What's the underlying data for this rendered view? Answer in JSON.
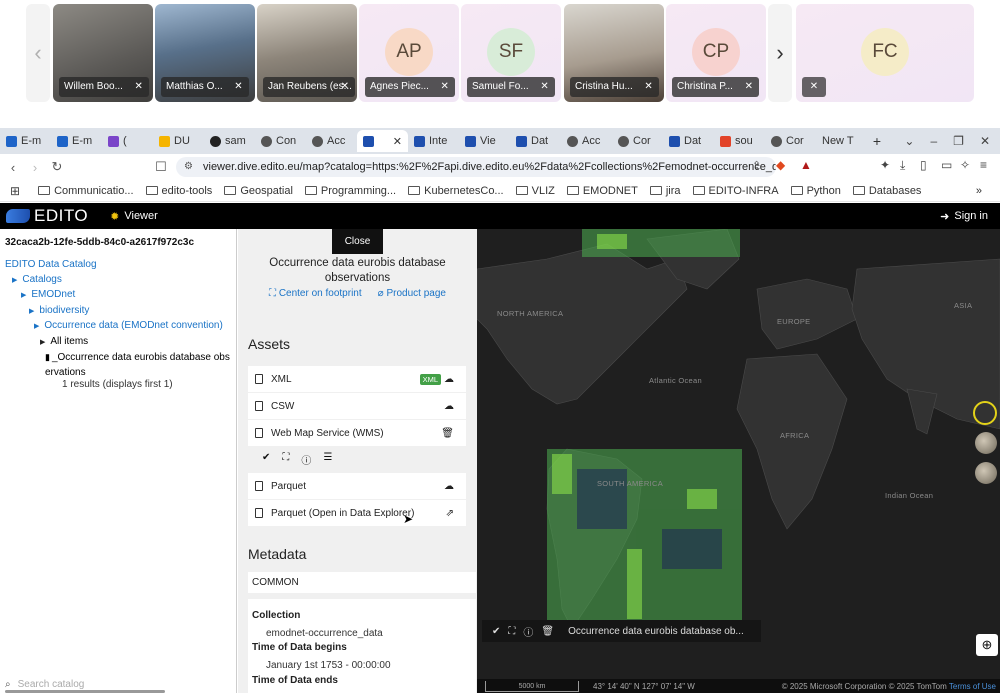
{
  "meeting": {
    "participants": [
      {
        "name": "Willem Boo...",
        "type": "photo"
      },
      {
        "name": "Matthias O...",
        "type": "photo"
      },
      {
        "name": "Jan Reubens (es...",
        "type": "photo"
      },
      {
        "name": "Agnes Piec...",
        "type": "avatar",
        "initials": "AP",
        "color": "#f8d9c6"
      },
      {
        "name": "Samuel Fo...",
        "type": "avatar",
        "initials": "SF",
        "color": "#d8ecd8"
      },
      {
        "name": "Cristina Hu...",
        "type": "photo"
      },
      {
        "name": "Christina P...",
        "type": "avatar",
        "initials": "CP",
        "color": "#f7d2cf"
      },
      {
        "name": "",
        "type": "avatar",
        "initials": "FC",
        "color": "#f5ecc8"
      }
    ],
    "prev_icon": "chevron-left-icon",
    "next_icon": "chevron-right-icon"
  },
  "browser": {
    "tabs": [
      {
        "label": "E-m",
        "favicon": "#1e64c8"
      },
      {
        "label": "E-m",
        "favicon": "#1e64c8"
      },
      {
        "label": "(",
        "favicon": "#7b45c9"
      },
      {
        "label": "DU",
        "favicon": "#f5b400"
      },
      {
        "label": "sam",
        "favicon": "#222222"
      },
      {
        "label": "Con",
        "favicon": "#555555"
      },
      {
        "label": "Acc",
        "favicon": "#555555"
      },
      {
        "label": "",
        "favicon": "#1e4fae",
        "active": true
      },
      {
        "label": "Inte",
        "favicon": "#1e4fae"
      },
      {
        "label": "Vie",
        "favicon": "#1e4fae"
      },
      {
        "label": "Dat",
        "favicon": "#1e4fae"
      },
      {
        "label": "Acc",
        "favicon": "#555555"
      },
      {
        "label": "Cor",
        "favicon": "#555555"
      },
      {
        "label": "Dat",
        "favicon": "#1e4fae"
      },
      {
        "label": "sou",
        "favicon": "#e24329"
      },
      {
        "label": "Cor",
        "favicon": "#555555"
      },
      {
        "label": "New T",
        "favicon": ""
      }
    ],
    "new_tab": "+",
    "url": "viewer.dive.edito.eu/map?catalog=https:%2F%2Fapi.dive.edito.eu%2Fdata%2Fcollections%2Femodnet-occurrence_data%...",
    "bookmarks": [
      "Communicatio...",
      "edito-tools",
      "Geospatial",
      "Programming...",
      "KubernetesCo...",
      "VLIZ",
      "EMODNET",
      "jira",
      "EDITO-INFRA",
      "Python",
      "Databases"
    ],
    "more": "»"
  },
  "app": {
    "logo": "EDITO",
    "section": "Viewer",
    "signin": "Sign in"
  },
  "catalog": {
    "item_id": "32caca2b-12fe-5ddb-84c0-a2617f972c3c",
    "tree": {
      "root": "EDITO Data Catalog",
      "catalogs": "Catalogs",
      "emodnet": "EMODnet",
      "biodiversity": "biodiversity",
      "occurrence": "Occurrence data (EMODnet convention)",
      "all_items": "All items",
      "item_line1": "_Occurrence data eurobis database obs",
      "item_line2": "ervations"
    },
    "results": "1 results (displays first 1)",
    "search_placeholder": "Search catalog"
  },
  "detail": {
    "close": "Close",
    "title": "Occurrence data eurobis database observations",
    "center": "Center on footprint",
    "product": "Product page",
    "assets_heading": "Assets",
    "assets": [
      {
        "label": "XML",
        "tag": "XML",
        "icon": "cloud-download-icon"
      },
      {
        "label": "CSW",
        "icon": "cloud-download-icon"
      },
      {
        "label": "Web Map Service (WMS)",
        "icon": "trash-icon"
      },
      {
        "label": "Parquet",
        "icon": "cloud-download-icon"
      },
      {
        "label": "Parquet (Open in Data Explorer)",
        "icon": "external-link-icon"
      }
    ],
    "metadata_heading": "Metadata",
    "metadata_section": "COMMON",
    "collection_key": "Collection",
    "collection_val": "emodnet-occurrence_data",
    "begins_key": "Time of Data begins",
    "begins_val": "January 1st 1753 - 00:00:00",
    "ends_key": "Time of Data ends"
  },
  "map": {
    "labels": {
      "north_america": "NORTH AMERICA",
      "europe": "EUROPE",
      "asia": "ASIA",
      "africa": "AFRICA",
      "south_america": "SOUTH AMERICA",
      "atlantic": "Atlantic Ocean",
      "indian": "Indian Ocean"
    },
    "layer_name": "Occurrence data eurobis database ob...",
    "scale": "5000 km",
    "coords": "43° 14' 40\" N 127° 07' 14\" W",
    "attribution": "© 2025 Microsoft Corporation © 2025 TomTom",
    "terms": "Terms of Use",
    "highlight_color": "#4caf50"
  }
}
